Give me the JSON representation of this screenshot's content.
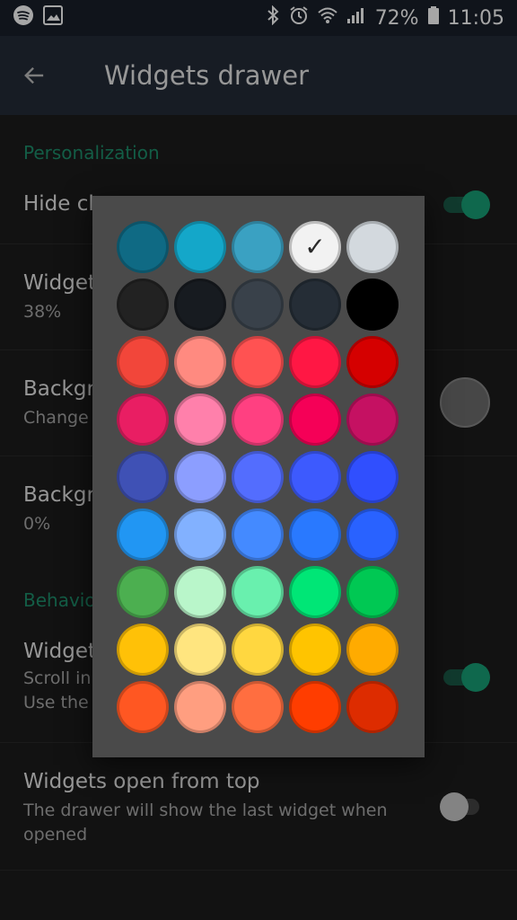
{
  "status_bar": {
    "battery": "72%",
    "time": "11:05"
  },
  "app_bar": {
    "title": "Widgets drawer"
  },
  "settings": {
    "personalization_header": "Personalization",
    "hide_item_title": "Hide cl",
    "widget_opacity_title": "Widget",
    "widget_opacity_value": "38%",
    "background_color_title": "Backgr",
    "background_color_sub": "Change",
    "background_transparency_title": "Backgr",
    "background_transparency_value": "0%",
    "behavior_header": "Behavio",
    "widget_scroll_title": "Widget",
    "widget_scroll_sub1": "Scroll in",
    "widget_scroll_sub2": "Use the",
    "open_from_top_title": "Widgets open from top",
    "open_from_top_sub": "The drawer will show the last widget when opened"
  },
  "palette": {
    "selected_index": 3,
    "colors": [
      "#0f6a84",
      "#14a7c9",
      "#3aa1c2",
      "#f2f2f2",
      "#d3d9de",
      "#222222",
      "#171b20",
      "#39414a",
      "#252d36",
      "#000000",
      "#f2463a",
      "#ff8a80",
      "#ff5252",
      "#ff1744",
      "#d50000",
      "#e91e63",
      "#ff80ab",
      "#ff4081",
      "#f50057",
      "#c51162",
      "#3f51b5",
      "#8c9eff",
      "#536dfe",
      "#3d5afe",
      "#304ffe",
      "#2196f3",
      "#82b1ff",
      "#448aff",
      "#2979ff",
      "#2962ff",
      "#4caf50",
      "#b9f6ca",
      "#69f0ae",
      "#00e676",
      "#00c853",
      "#ffc107",
      "#ffe57f",
      "#ffd740",
      "#ffc400",
      "#ffab00",
      "#ff5722",
      "#ff9e80",
      "#ff6e40",
      "#ff3d00",
      "#dd2c00"
    ],
    "check_glyph": "✓"
  }
}
